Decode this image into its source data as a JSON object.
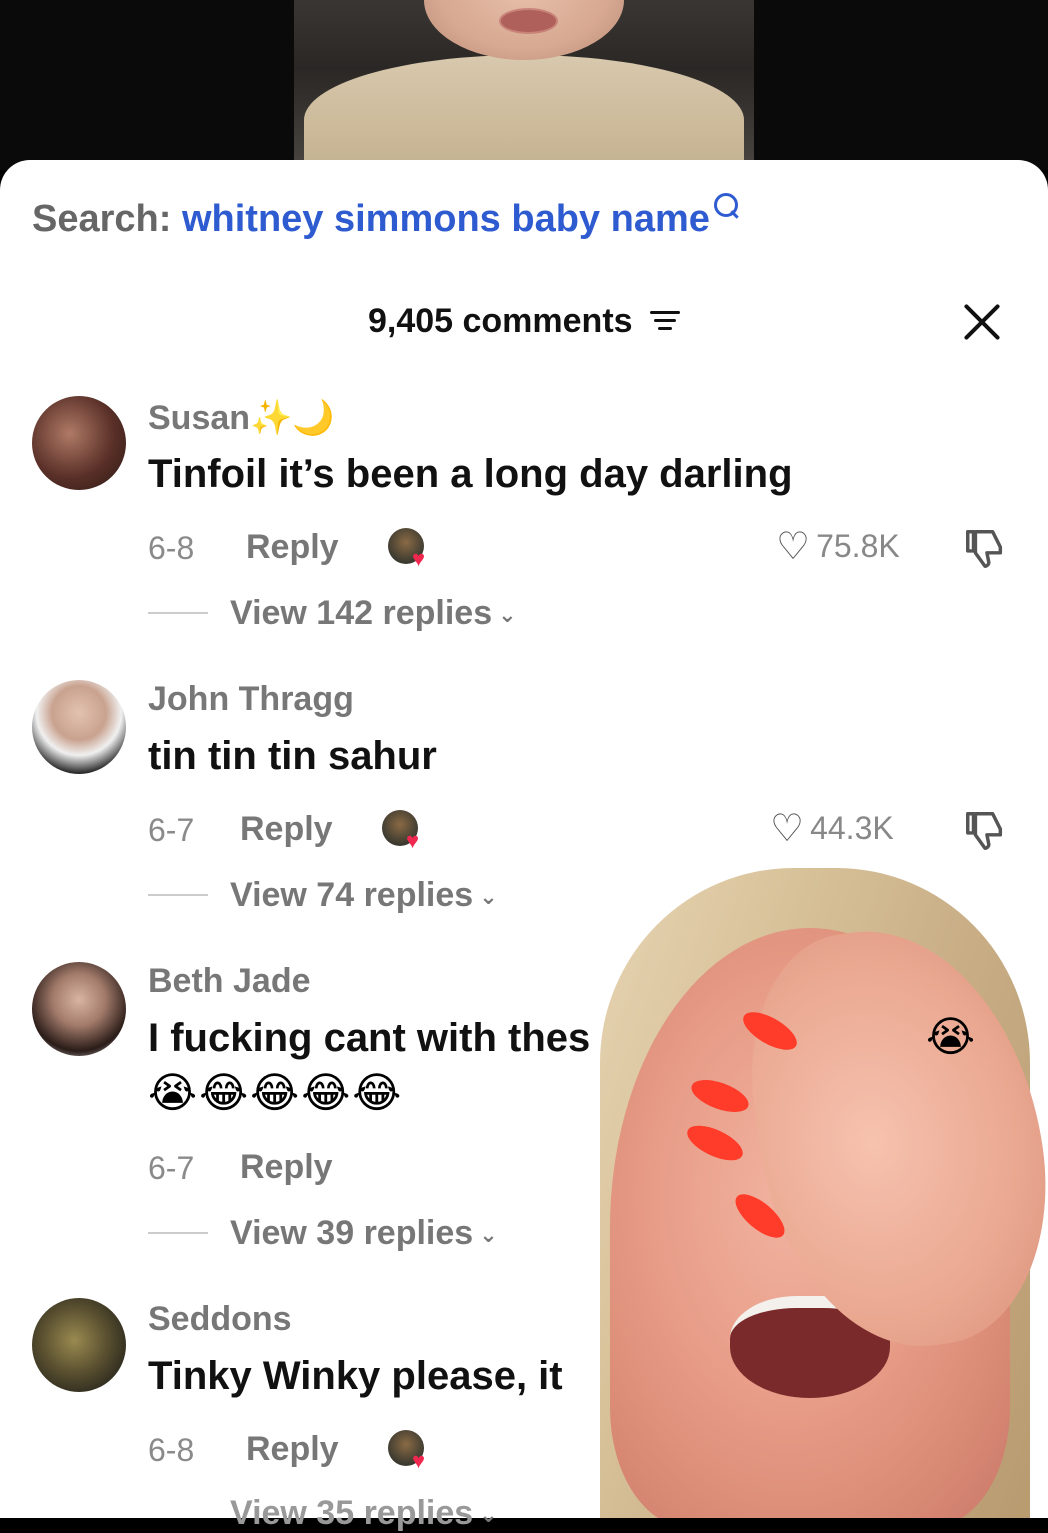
{
  "search": {
    "prefix": "Search:",
    "query": "whitney simmons baby name"
  },
  "header": {
    "comments_count": "9,405 comments"
  },
  "comments": [
    {
      "username": "Susan✨🌙",
      "text": "Tinfoil it’s been a long day darling",
      "date": "6-8",
      "reply_label": "Reply",
      "likes": "75.8K",
      "view_replies": "View 142 replies"
    },
    {
      "username": "John Thragg",
      "text": "tin tin tin sahur",
      "date": "6-7",
      "reply_label": "Reply",
      "likes": "44.3K",
      "view_replies": "View 74 replies"
    },
    {
      "username": "Beth Jade",
      "text": "I fucking cant with thes",
      "text_end_emoji": "😭",
      "emoji_line": "😭😂😂😂😂",
      "date": "6-7",
      "reply_label": "Reply",
      "view_replies": "View 39 replies"
    },
    {
      "username": "Seddons",
      "text": "Tinky Winky please, it",
      "date": "6-8",
      "reply_label": "Reply",
      "view_replies": "View 35 replies"
    }
  ],
  "colors": {
    "accent_query": "#2f5bd1",
    "liked_heart": "#f0274e",
    "nails": "#ff3b2a"
  }
}
